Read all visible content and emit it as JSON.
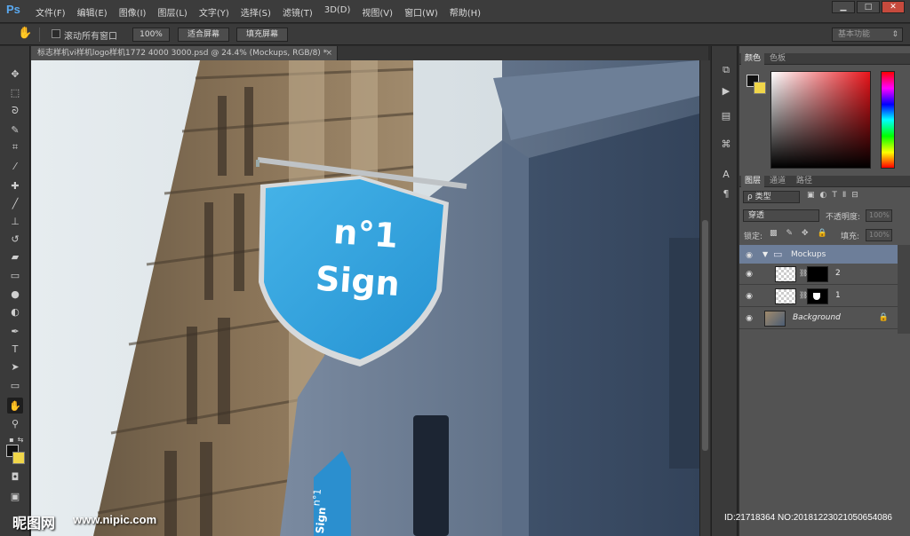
{
  "app": {
    "logo": "Ps",
    "menus": [
      "文件(F)",
      "编辑(E)",
      "图像(I)",
      "图层(L)",
      "文字(Y)",
      "选择(S)",
      "滤镜(T)",
      "3D(D)",
      "视图(V)",
      "窗口(W)",
      "帮助(H)"
    ],
    "window_buttons": {
      "minimize": "▁",
      "restore": "□",
      "close": "✕"
    }
  },
  "options_bar": {
    "scroll_all_label": "滚动所有窗口",
    "scroll_all_checked": false,
    "btn_100": "100%",
    "btn_fit": "适合屏幕",
    "btn_fill": "填充屏幕",
    "workspace": "基本功能"
  },
  "document": {
    "tab_title": "标志样机vi样机logo样机1772 4000 3000.psd @ 24.4% (Mockups, RGB/8) *",
    "close": "×",
    "sign_line1": "n°1",
    "sign_line2": "Sign",
    "small_sign_line1": "n°1",
    "small_sign_line2": "Sign"
  },
  "colors": {
    "foreground": "#111111",
    "background": "#f0d64a",
    "sign_blue": "#2fa4de"
  },
  "color_panel": {
    "tab_color": "颜色",
    "tab_swatches": "色板"
  },
  "layers_panel": {
    "tab_layers": "图层",
    "tab_channels": "通道",
    "tab_paths": "路径",
    "filter_kind": "ρ 类型",
    "blend_mode": "穿透",
    "opacity_label": "不透明度:",
    "opacity_value": "100%",
    "lock_label": "锁定:",
    "fill_label": "填充:",
    "fill_value": "100%",
    "layers": [
      {
        "name": "Mockups",
        "type": "group"
      },
      {
        "name": "2",
        "type": "smart"
      },
      {
        "name": "1",
        "type": "smart"
      },
      {
        "name": "Background",
        "type": "background"
      }
    ]
  },
  "watermark": {
    "site_logo": "昵图网",
    "url": "www.nipic.com",
    "id_text": "ID:21718364 NO:20181223021050654086"
  }
}
